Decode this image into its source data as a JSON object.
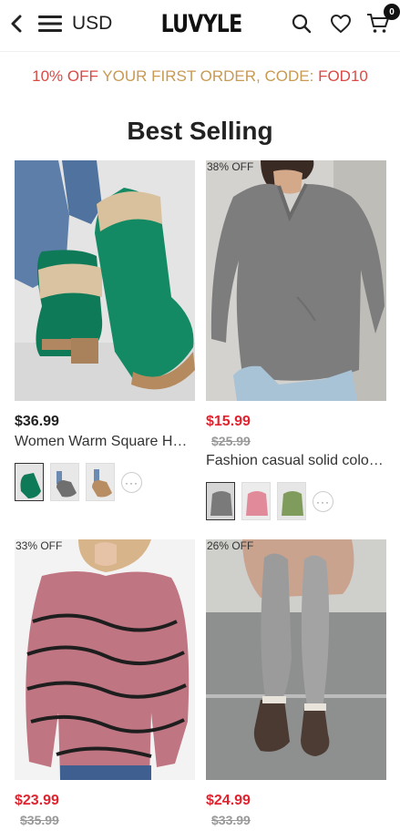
{
  "header": {
    "currency": "USD",
    "logo": "LUVYLE",
    "cart_count": "0",
    "icons": [
      "back-icon",
      "menu-icon",
      "search-icon",
      "heart-icon",
      "cart-icon"
    ]
  },
  "promo": {
    "part1": "10% OFF ",
    "part2": "YOUR FIRST ORDER, CODE: ",
    "part3": "FOD10"
  },
  "section": {
    "title": "Best Selling"
  },
  "products": [
    {
      "price": "$36.99",
      "old_price": "",
      "name": "Women Warm Square Heel Mid-Calf Boots",
      "discount": ""
    },
    {
      "price": "$15.99",
      "old_price": "$25.99",
      "name": "Fashion casual solid color V-neck top",
      "discount": "38% OFF"
    },
    {
      "price": "$23.99",
      "old_price": "$35.99",
      "name": "",
      "discount": "33% OFF"
    },
    {
      "price": "$24.99",
      "old_price": "$33.99",
      "name": "",
      "discount": "26% OFF"
    }
  ],
  "more_label": "···",
  "colors": {
    "sale_red": "#e0242f",
    "promo_red": "#d94a45",
    "promo_gold": "#c89a52"
  }
}
